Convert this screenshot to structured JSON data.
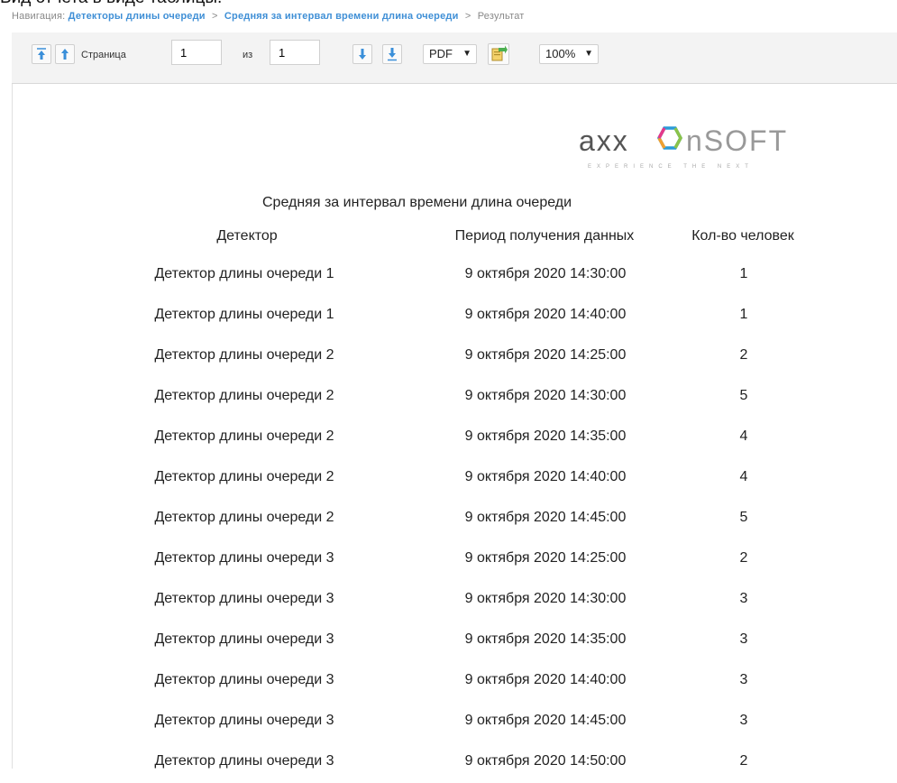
{
  "caption": "Вид отчета в виде таблицы.",
  "breadcrumb": {
    "prefix": "Навигация:",
    "items": [
      "Детекторы длины очереди",
      "Средняя за интервал времени длина очереди"
    ],
    "current": "Результат",
    "separator": ">"
  },
  "toolbar": {
    "page_label": "Страница",
    "page_value": "1",
    "of_label": "из",
    "total_pages": "1",
    "format_value": "PDF",
    "zoom_value": "100%",
    "icons": [
      "first-page-icon",
      "prev-page-icon",
      "next-page-icon",
      "last-page-icon",
      "export-icon",
      "chevron-down-icon"
    ]
  },
  "logo": {
    "text": "axxonsoft",
    "tagline": "EXPERIENCE THE NEXT"
  },
  "report": {
    "title": "Средняя за интервал времени длина очереди",
    "columns": [
      "Детектор",
      "Период получения данных",
      "Кол-во человек"
    ],
    "rows": [
      [
        "Детектор длины очереди 1",
        "9 октября 2020 14:30:00",
        "1"
      ],
      [
        "Детектор длины очереди 1",
        "9 октября 2020 14:40:00",
        "1"
      ],
      [
        "Детектор длины очереди 2",
        "9 октября 2020 14:25:00",
        "2"
      ],
      [
        "Детектор длины очереди 2",
        "9 октября 2020 14:30:00",
        "5"
      ],
      [
        "Детектор длины очереди 2",
        "9 октября 2020 14:35:00",
        "4"
      ],
      [
        "Детектор длины очереди 2",
        "9 октября 2020 14:40:00",
        "4"
      ],
      [
        "Детектор длины очереди 2",
        "9 октября 2020 14:45:00",
        "5"
      ],
      [
        "Детектор длины очереди 3",
        "9 октября 2020 14:25:00",
        "2"
      ],
      [
        "Детектор длины очереди 3",
        "9 октября 2020 14:30:00",
        "3"
      ],
      [
        "Детектор длины очереди 3",
        "9 октября 2020 14:35:00",
        "3"
      ],
      [
        "Детектор длины очереди 3",
        "9 октября 2020 14:40:00",
        "3"
      ],
      [
        "Детектор длины очереди 3",
        "9 октября 2020 14:45:00",
        "3"
      ],
      [
        "Детектор длины очереди 3",
        "9 октября 2020 14:50:00",
        "2"
      ]
    ]
  },
  "colors": {
    "link": "#3f8fd6",
    "toolbar_bg": "#f3f3f3",
    "icon_blue": "#3a8fd9",
    "text": "#222222"
  }
}
